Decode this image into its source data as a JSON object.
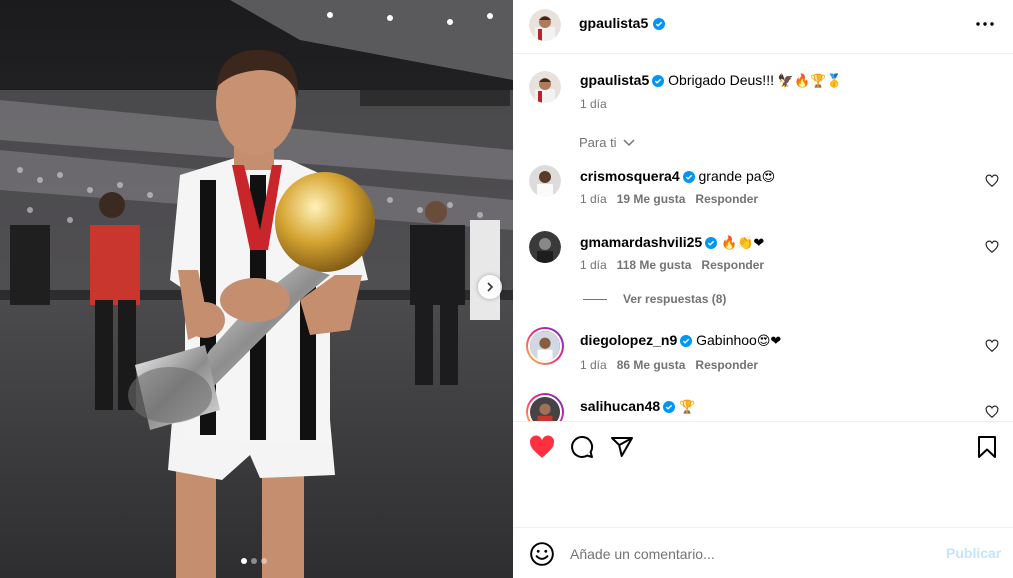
{
  "post": {
    "author": "gpaulista5",
    "carousel_total": 3,
    "carousel_active": 1
  },
  "caption": {
    "username": "gpaulista5",
    "text": "Obrigado Deus!!!",
    "emojis": "🦅🔥🏆🥇",
    "time": "1 día"
  },
  "sort": {
    "label": "Para ti"
  },
  "comments": [
    {
      "username": "crismosquera4",
      "text": "grande pa",
      "emojis": "😍",
      "time": "1 día",
      "likes": "19 Me gusta",
      "reply": "Responder"
    },
    {
      "username": "gmamardashvili25",
      "text": "",
      "emojis": "🔥👏❤",
      "time": "1 día",
      "likes": "118 Me gusta",
      "reply": "Responder"
    },
    {
      "username": "diegolopez_n9",
      "text": "Gabinhoo",
      "emojis": "😍❤",
      "time": "1 día",
      "likes": "86 Me gusta",
      "reply": "Responder"
    },
    {
      "username": "salihucan48",
      "text": "",
      "emojis": "🏆",
      "time": "",
      "likes": "",
      "reply": ""
    }
  ],
  "view_replies": "Ver respuestas (8)",
  "composer": {
    "placeholder": "Añade un comentario...",
    "publish": "Publicar"
  },
  "colors": {
    "like_red": "#ff3040",
    "verified_blue": "#0095f6",
    "muted_text": "#737373",
    "publish_disabled": "#c5e4fd"
  },
  "icons": [
    "more-options-icon",
    "verified-badge-icon",
    "heart-icon",
    "comment-icon",
    "share-icon",
    "bookmark-icon",
    "emoji-icon",
    "chevron-down-icon",
    "chevron-right-icon"
  ]
}
